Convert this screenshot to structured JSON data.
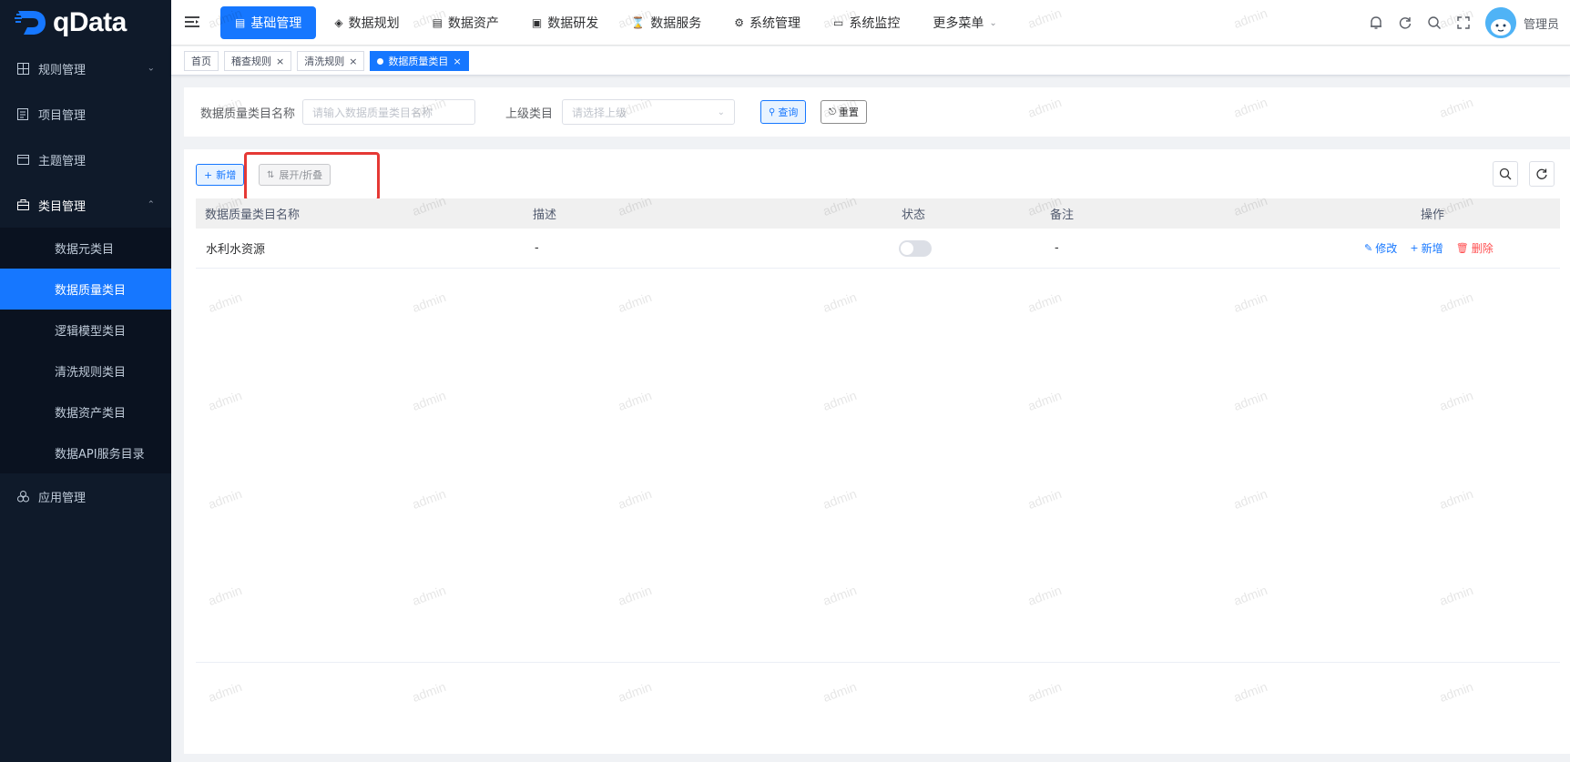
{
  "brand": {
    "name": "qData"
  },
  "sidebar": {
    "items": [
      {
        "label": "规则管理",
        "icon": "grid-icon",
        "expanded": false
      },
      {
        "label": "项目管理",
        "icon": "document-icon"
      },
      {
        "label": "主题管理",
        "icon": "calendar-icon"
      },
      {
        "label": "类目管理",
        "icon": "briefcase-icon",
        "expanded": true
      },
      {
        "label": "应用管理",
        "icon": "cluster-icon"
      }
    ],
    "subitems": [
      {
        "label": "数据元类目"
      },
      {
        "label": "数据质量类目",
        "active": true
      },
      {
        "label": "逻辑模型类目"
      },
      {
        "label": "清洗规则类目"
      },
      {
        "label": "数据资产类目"
      },
      {
        "label": "数据API服务目录"
      }
    ]
  },
  "topnav": {
    "items": [
      {
        "label": "基础管理",
        "active": true
      },
      {
        "label": "数据规划"
      },
      {
        "label": "数据资产"
      },
      {
        "label": "数据研发"
      },
      {
        "label": "数据服务"
      },
      {
        "label": "系统管理"
      },
      {
        "label": "系统监控"
      },
      {
        "label": "更多菜单"
      }
    ],
    "user_name": "管理员"
  },
  "tags": [
    {
      "label": "首页",
      "closable": false
    },
    {
      "label": "稽查规则",
      "closable": true
    },
    {
      "label": "清洗规则",
      "closable": true
    },
    {
      "label": "数据质量类目",
      "closable": true,
      "active": true
    }
  ],
  "search": {
    "name_label": "数据质量类目名称",
    "name_placeholder": "请输入数据质量类目名称",
    "parent_label": "上级类目",
    "parent_placeholder": "请选择上级",
    "query_label": "查询",
    "reset_label": "重置"
  },
  "toolbar": {
    "add_label": "新增",
    "toggle_label": "展开/折叠"
  },
  "table": {
    "columns": [
      "数据质量类目名称",
      "描述",
      "状态",
      "备注",
      "操作"
    ],
    "rows": [
      {
        "name": "水利水资源",
        "desc": "-",
        "status_on": false,
        "remark": "-"
      }
    ],
    "actions": {
      "edit": "修改",
      "add": "新增",
      "delete": "删除"
    }
  },
  "watermark": "admin",
  "colors": {
    "primary": "#1677ff",
    "sidebar_bg": "#0f1a2a",
    "danger": "#ff4d4f",
    "highlight": "#e53935"
  }
}
